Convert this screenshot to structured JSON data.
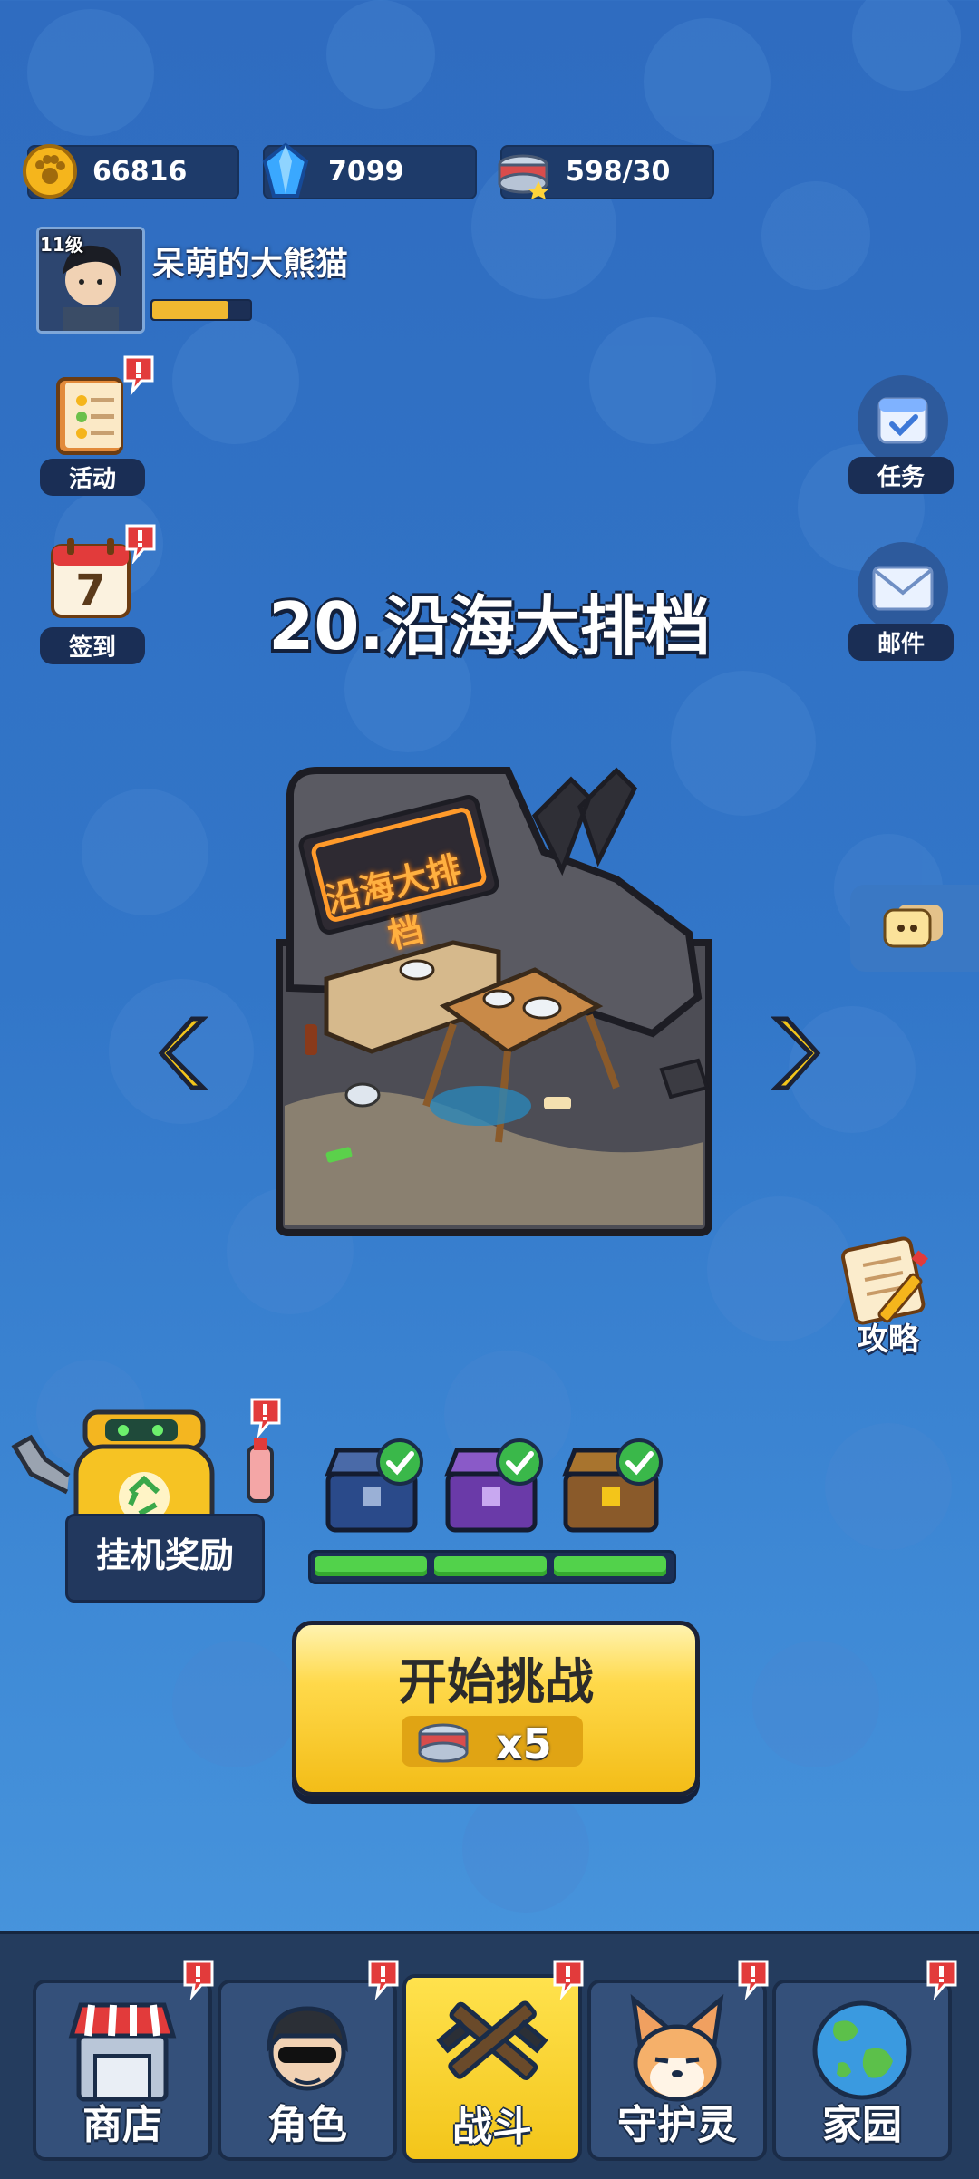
{
  "resources": {
    "coins": "66816",
    "gems": "7099",
    "energy": "598/30"
  },
  "profile": {
    "level": "11级",
    "name": "呆萌的大熊猫",
    "xp_progress": 0.78
  },
  "side_left": {
    "activity_label": "活动",
    "checkin_label": "签到",
    "checkin_day": "7"
  },
  "side_right": {
    "tasks_label": "任务",
    "mail_label": "邮件",
    "guide_label": "攻略"
  },
  "stage": {
    "title": "20.沿海大排档",
    "sign_text": "沿海大排档"
  },
  "afk": {
    "label": "挂机奖励"
  },
  "chests": {
    "progress": 1.0,
    "states": [
      "claimed",
      "claimed",
      "claimed"
    ]
  },
  "start": {
    "label": "开始挑战",
    "cost": "x5"
  },
  "nav": {
    "tabs": [
      {
        "label": "商店",
        "icon": "shop-icon"
      },
      {
        "label": "角色",
        "icon": "character-icon"
      },
      {
        "label": "战斗",
        "icon": "battle-icon"
      },
      {
        "label": "守护灵",
        "icon": "guardian-icon"
      },
      {
        "label": "家园",
        "icon": "home-icon"
      }
    ],
    "active_index": 2
  },
  "colors": {
    "accent_yellow": "#f3c51a",
    "badge_red": "#e23b3b",
    "progress_green": "#52d24b"
  }
}
